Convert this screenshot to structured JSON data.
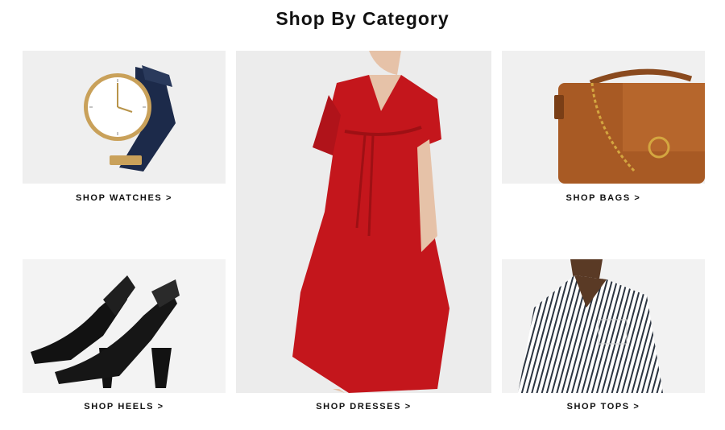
{
  "page": {
    "heading": "Shop By Category"
  },
  "categories": {
    "watches": {
      "label": "SHOP WATCHES >",
      "image": "watch"
    },
    "dresses": {
      "label": "SHOP DRESSES >",
      "image": "red-dress"
    },
    "bags": {
      "label": "SHOP BAGS >",
      "image": "brown-handbag"
    },
    "heels": {
      "label": "SHOP HEELS >",
      "image": "black-heels"
    },
    "tops": {
      "label": "SHOP TOPS >",
      "image": "striped-shirt"
    }
  },
  "colors": {
    "dress_red": "#c4161c",
    "bag_brown": "#a85a24",
    "watch_strap": "#1c2a4a",
    "chain_gold": "#d4a640"
  }
}
